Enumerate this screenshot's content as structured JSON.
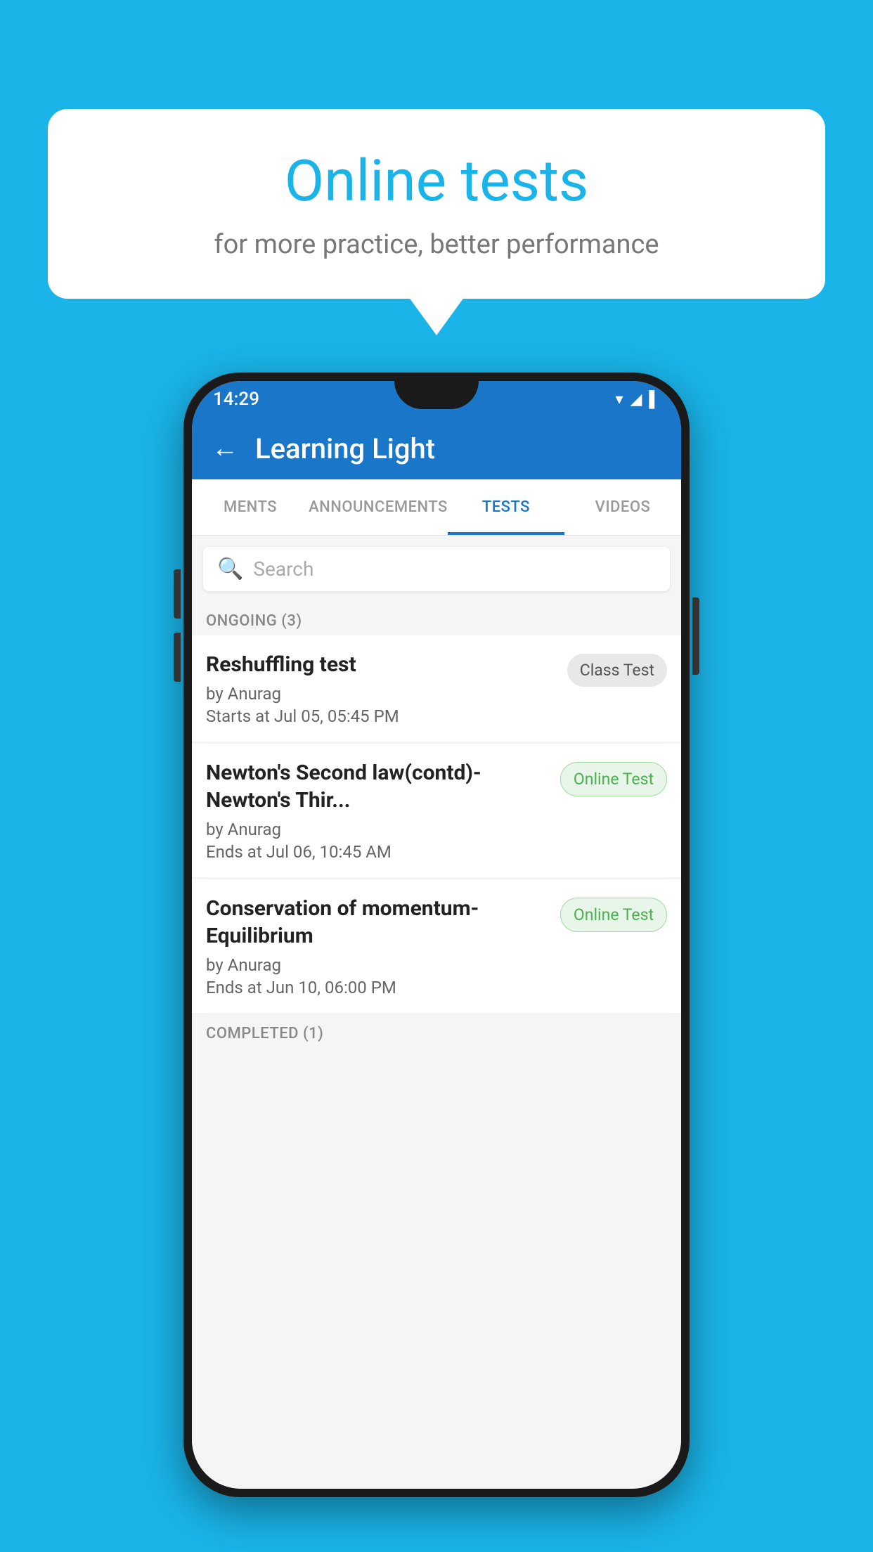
{
  "background": {
    "color": "#1ab4e8"
  },
  "bubble": {
    "title": "Online tests",
    "subtitle": "for more practice, better performance"
  },
  "phone": {
    "status_bar": {
      "time": "14:29",
      "icons": "▼◀▌"
    },
    "app_bar": {
      "title": "Learning Light",
      "back_label": "←"
    },
    "tabs": [
      {
        "label": "MENTS",
        "active": false
      },
      {
        "label": "ANNOUNCEMENTS",
        "active": false
      },
      {
        "label": "TESTS",
        "active": true
      },
      {
        "label": "VIDEOS",
        "active": false
      }
    ],
    "search": {
      "placeholder": "Search"
    },
    "section_ongoing": {
      "label": "ONGOING (3)"
    },
    "tests": [
      {
        "name": "Reshuffling test",
        "by": "by Anurag",
        "time_label": "Starts at",
        "time": "Jul 05, 05:45 PM",
        "badge": "Class Test",
        "badge_type": "class"
      },
      {
        "name": "Newton's Second law(contd)-Newton's Thir...",
        "by": "by Anurag",
        "time_label": "Ends at",
        "time": "Jul 06, 10:45 AM",
        "badge": "Online Test",
        "badge_type": "online"
      },
      {
        "name": "Conservation of momentum-Equilibrium",
        "by": "by Anurag",
        "time_label": "Ends at",
        "time": "Jun 10, 06:00 PM",
        "badge": "Online Test",
        "badge_type": "online"
      }
    ],
    "section_completed": {
      "label": "COMPLETED (1)"
    }
  }
}
